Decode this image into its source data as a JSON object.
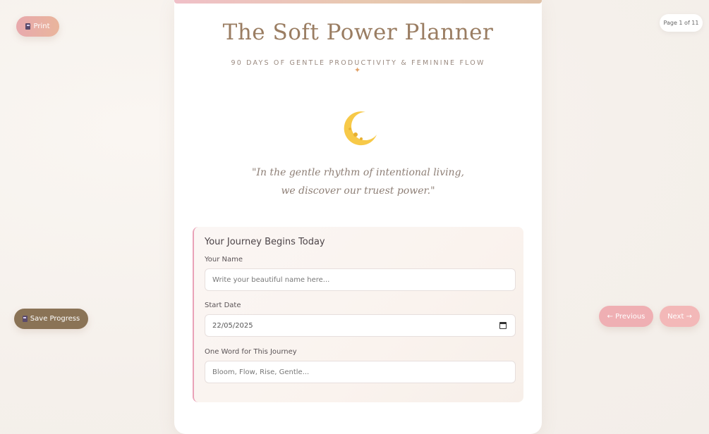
{
  "controls": {
    "print_label": "Print",
    "save_label": "Save Progress",
    "previous_label": "← Previous",
    "next_label": "Next →",
    "page_indicator": "Page 1 of 11"
  },
  "cover": {
    "title": "The Soft Power Planner",
    "subtitle": "90 DAYS OF GENTLE PRODUCTIVITY & FEMININE FLOW",
    "sparkle": "✦",
    "quote_line1": "\"In the gentle rhythm of intentional living,",
    "quote_line2": "we discover our truest power.\""
  },
  "form": {
    "heading": "Your Journey Begins Today",
    "name_label": "Your Name",
    "name_placeholder": "Write your beautiful name here...",
    "date_label": "Start Date",
    "date_value": "22/05/2025",
    "word_label": "One Word for This Journey",
    "word_placeholder": "Bloom, Flow, Rise, Gentle..."
  },
  "icons": {
    "print": "printer-icon",
    "save": "floppy-disk-icon",
    "moon": "crescent-moon-icon",
    "calendar": "calendar-icon"
  }
}
